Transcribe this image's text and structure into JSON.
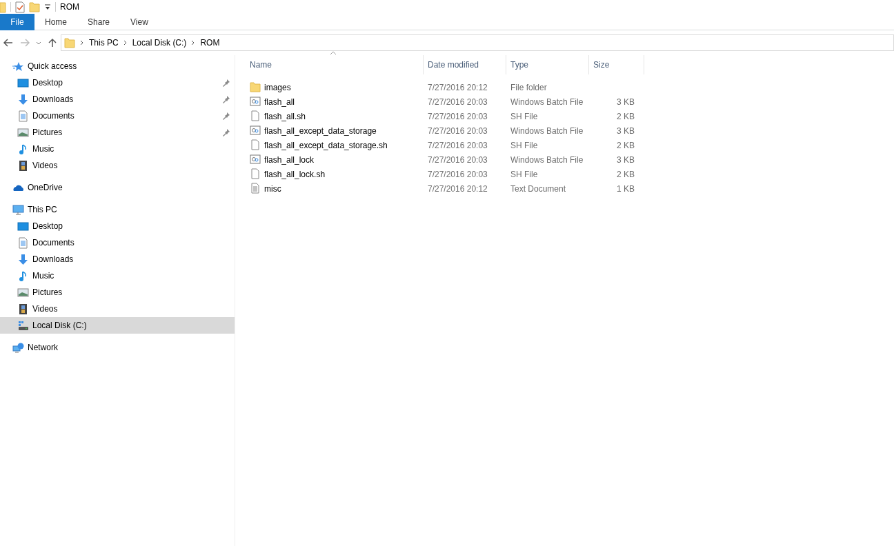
{
  "window": {
    "title": "ROM"
  },
  "ribbon_tabs": [
    {
      "label": "File",
      "kind": "file",
      "selected": false
    },
    {
      "label": "Home",
      "kind": "tab",
      "selected": false
    },
    {
      "label": "Share",
      "kind": "tab",
      "selected": false
    },
    {
      "label": "View",
      "kind": "tab",
      "selected": false
    }
  ],
  "address_bar": {
    "crumbs": [
      "This PC",
      "Local Disk (C:)",
      "ROM"
    ]
  },
  "sidebar": {
    "groups": [
      {
        "label": "Quick access",
        "kind": "star",
        "selected": false,
        "children": [
          {
            "label": "Desktop",
            "kind": "desktop",
            "pinned": true,
            "selected": false
          },
          {
            "label": "Downloads",
            "kind": "downloads",
            "pinned": true,
            "selected": false
          },
          {
            "label": "Documents",
            "kind": "documents",
            "pinned": true,
            "selected": false
          },
          {
            "label": "Pictures",
            "kind": "pictures",
            "pinned": true,
            "selected": false
          },
          {
            "label": "Music",
            "kind": "music",
            "pinned": false,
            "selected": false
          },
          {
            "label": "Videos",
            "kind": "videos",
            "pinned": false,
            "selected": false
          }
        ]
      },
      {
        "label": "OneDrive",
        "kind": "cloud",
        "selected": false
      },
      {
        "label": "This PC",
        "kind": "pc",
        "selected": false,
        "children": [
          {
            "label": "Desktop",
            "kind": "desktop",
            "pinned": false,
            "selected": false
          },
          {
            "label": "Documents",
            "kind": "documents",
            "pinned": false,
            "selected": false
          },
          {
            "label": "Downloads",
            "kind": "downloads",
            "pinned": false,
            "selected": false
          },
          {
            "label": "Music",
            "kind": "music",
            "pinned": false,
            "selected": false
          },
          {
            "label": "Pictures",
            "kind": "pictures",
            "pinned": false,
            "selected": false
          },
          {
            "label": "Videos",
            "kind": "videos",
            "pinned": false,
            "selected": false
          },
          {
            "label": "Local Disk (C:)",
            "kind": "disk",
            "pinned": false,
            "selected": true
          }
        ]
      },
      {
        "label": "Network",
        "kind": "network",
        "selected": false
      }
    ]
  },
  "file_list": {
    "columns": [
      "Name",
      "Date modified",
      "Type",
      "Size"
    ],
    "rows": [
      {
        "kind": "folder",
        "name": "images",
        "date": "7/27/2016 20:12",
        "type": "File folder"
      },
      {
        "kind": "batch",
        "name": "flash_all",
        "date": "7/27/2016 20:03",
        "type": "Windows Batch File",
        "size": "3 KB"
      },
      {
        "kind": "sh",
        "name": "flash_all.sh",
        "date": "7/27/2016 20:03",
        "type": "SH File",
        "size": "2 KB"
      },
      {
        "kind": "batch",
        "name": "flash_all_except_data_storage",
        "date": "7/27/2016 20:03",
        "type": "Windows Batch File",
        "size": "3 KB"
      },
      {
        "kind": "sh",
        "name": "flash_all_except_data_storage.sh",
        "date": "7/27/2016 20:03",
        "type": "SH File",
        "size": "2 KB"
      },
      {
        "kind": "batch",
        "name": "flash_all_lock",
        "date": "7/27/2016 20:03",
        "type": "Windows Batch File",
        "size": "3 KB"
      },
      {
        "kind": "sh",
        "name": "flash_all_lock.sh",
        "date": "7/27/2016 20:03",
        "type": "SH File",
        "size": "2 KB"
      },
      {
        "kind": "text",
        "name": "misc",
        "date": "7/27/2016 20:12",
        "type": "Text Document",
        "size": "1 KB"
      }
    ]
  }
}
